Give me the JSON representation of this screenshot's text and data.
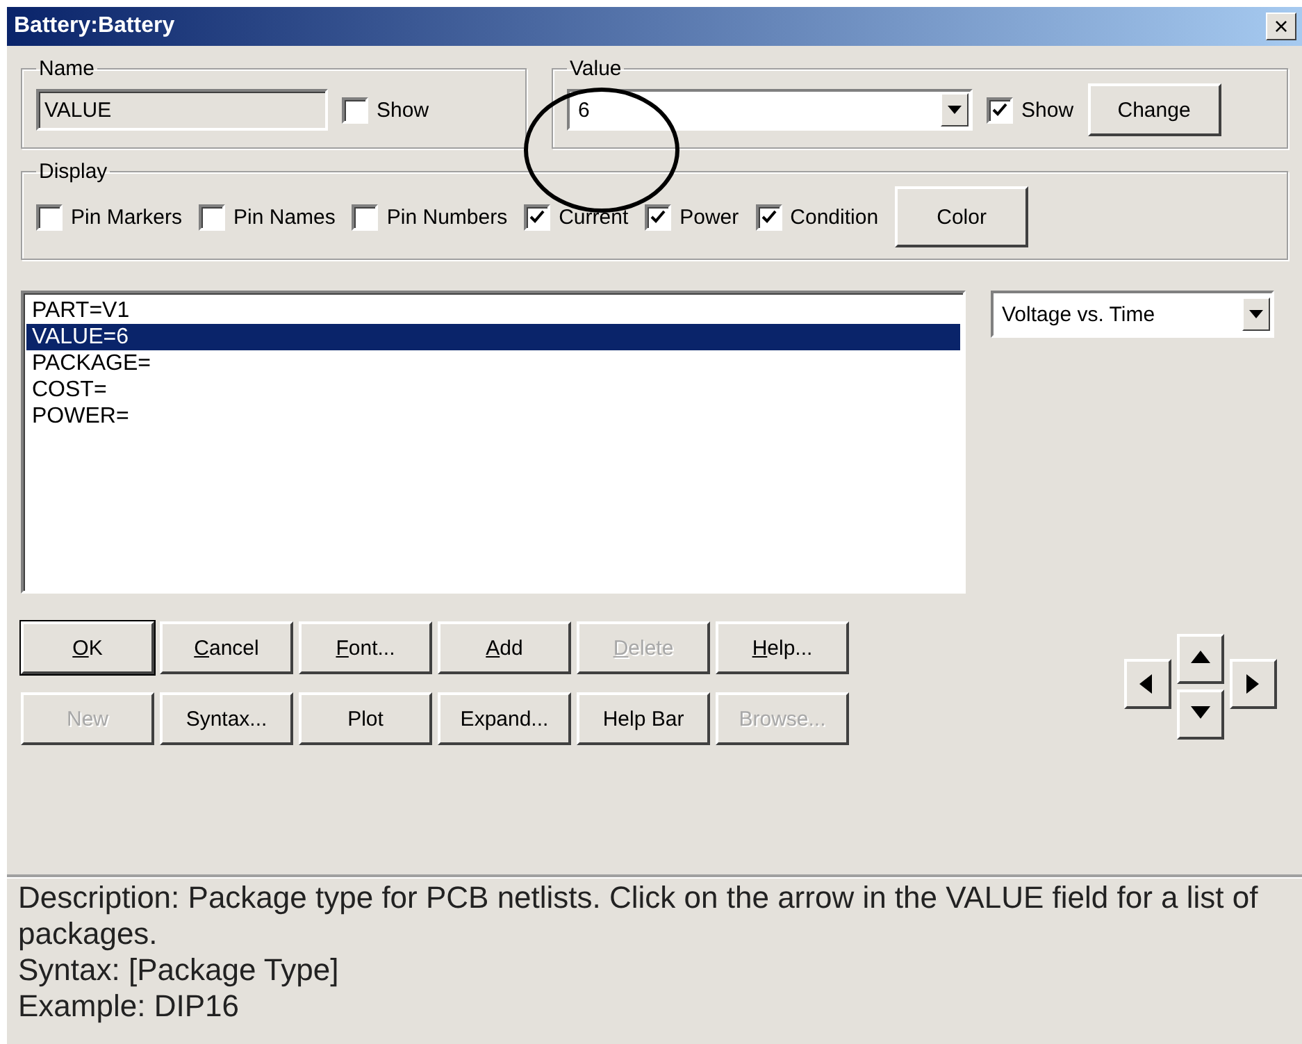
{
  "window": {
    "title": "Battery:Battery",
    "close": "×"
  },
  "name_group": {
    "legend": "Name",
    "value": "VALUE",
    "show": {
      "label": "Show",
      "checked": false
    }
  },
  "value_group": {
    "legend": "Value",
    "value": "6",
    "show": {
      "label": "Show",
      "checked": true
    },
    "button": "Change"
  },
  "display_group": {
    "legend": "Display",
    "checkboxes": [
      {
        "label": "Pin Markers",
        "checked": false
      },
      {
        "label": "Pin Names",
        "checked": false
      },
      {
        "label": "Pin Numbers",
        "checked": false
      },
      {
        "label": "Current",
        "checked": true
      },
      {
        "label": "Power",
        "checked": true
      },
      {
        "label": "Condition",
        "checked": true
      }
    ],
    "button": "Color"
  },
  "attributes": [
    {
      "text": "PART=V1",
      "selected": false
    },
    {
      "text": "VALUE=6",
      "selected": true
    },
    {
      "text": "PACKAGE=",
      "selected": false
    },
    {
      "text": "COST=",
      "selected": false
    },
    {
      "text": "POWER=",
      "selected": false
    }
  ],
  "plot_select": {
    "value": "Voltage vs. Time"
  },
  "buttons": [
    [
      {
        "label": "OK",
        "disabled": false,
        "default": true,
        "mnemonic": true
      },
      {
        "label": "Cancel",
        "disabled": false,
        "default": false,
        "mnemonic": true
      },
      {
        "label": "Font...",
        "disabled": false,
        "default": false,
        "mnemonic": true
      },
      {
        "label": "Add",
        "disabled": false,
        "default": false,
        "mnemonic": true
      },
      {
        "label": "Delete",
        "disabled": true,
        "default": false,
        "mnemonic": true
      },
      {
        "label": "Help...",
        "disabled": false,
        "default": false,
        "mnemonic": true
      }
    ],
    [
      {
        "label": "New",
        "disabled": true,
        "default": false,
        "mnemonic": false
      },
      {
        "label": "Syntax...",
        "disabled": false,
        "default": false,
        "mnemonic": false
      },
      {
        "label": "Plot",
        "disabled": false,
        "default": false,
        "mnemonic": false
      },
      {
        "label": "Expand...",
        "disabled": false,
        "default": false,
        "mnemonic": false
      },
      {
        "label": "Help Bar",
        "disabled": false,
        "default": false,
        "mnemonic": false
      },
      {
        "label": "Browse...",
        "disabled": true,
        "default": false,
        "mnemonic": false
      }
    ]
  ],
  "description": [
    "Description: Package type for PCB netlists. Click on the arrow in the VALUE field for a list of packages.",
    "Syntax: [Package Type]",
    "Example: DIP16"
  ]
}
